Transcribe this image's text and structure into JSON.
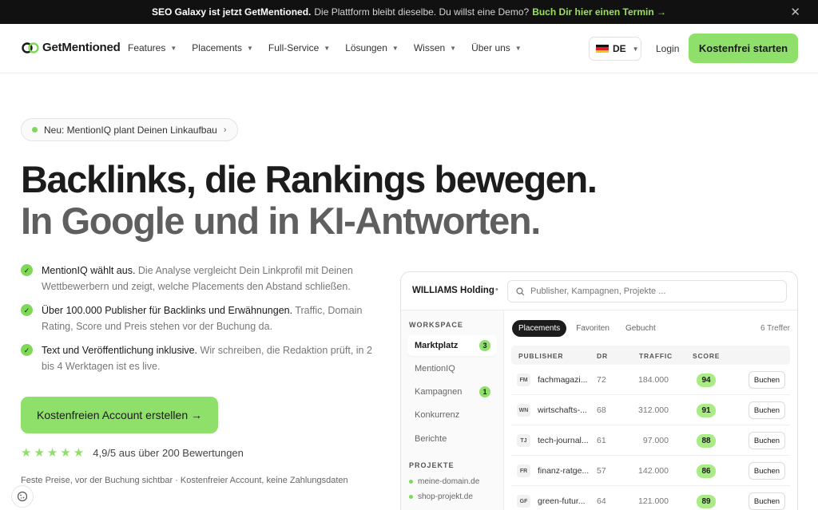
{
  "banner": {
    "bold": "SEO Galaxy ist jetzt GetMentioned.",
    "text": "Die Plattform bleibt dieselbe. Du willst eine Demo?",
    "link": "Buch Dir hier einen Termin →",
    "close": "✕"
  },
  "nav": {
    "brand": "GetMentioned",
    "menu": [
      {
        "label": "Features"
      },
      {
        "label": "Placements"
      },
      {
        "label": "Full-Service"
      },
      {
        "label": "Lösungen"
      },
      {
        "label": "Wissen"
      },
      {
        "label": "Über uns"
      }
    ],
    "language": "DE",
    "login": "Login",
    "cta": "Kostenfrei starten"
  },
  "hero": {
    "pill": "Neu: MentionIQ plant Deinen Linkaufbau",
    "headline_1": "Backlinks, die Rankings bewegen.",
    "headline_2": "In Google und in KI-Antworten.",
    "features": [
      {
        "strong": "MentionIQ wählt aus.",
        "text": "Die Analyse vergleicht Dein Linkprofil mit Deinen Wettbewerbern und zeigt, welche Placements den Abstand schließen."
      },
      {
        "strong": "Über 100.000 Publisher für Backlinks und Erwähnungen.",
        "text": "Traffic, Domain Rating, Score und Preis stehen vor der Buchung da."
      },
      {
        "strong": "Text und Veröffentlichung inklusive.",
        "text": "Wir schreiben, die Redaktion prüft, in 2 bis 4 Werktagen ist es live."
      }
    ],
    "cta": "Kostenfreien Account erstellen →",
    "stars": "★★★★★",
    "rating": "4,9/5 aus über 200 Bewertungen",
    "fineprint": "Feste Preise, vor der Buchung sichtbar · Kostenfreier Account, keine Zahlungsdaten"
  },
  "app": {
    "workspace_name": "WILLIAMS Holding",
    "separator": "•",
    "search_placeholder": "Publisher, Kampagnen, Projekte ...",
    "sidebar": {
      "workspace_heading": "WORKSPACE",
      "items": [
        {
          "label": "Marktplatz",
          "badge": "3"
        },
        {
          "label": "MentionIQ",
          "badge": ""
        },
        {
          "label": "Kampagnen",
          "badge": "1"
        },
        {
          "label": "Konkurrenz",
          "badge": ""
        },
        {
          "label": "Berichte",
          "badge": ""
        }
      ],
      "projects_heading": "PROJEKTE",
      "projects": [
        "meine-domain.de",
        "shop-projekt.de"
      ]
    },
    "tabs": [
      "Placements",
      "Favoriten",
      "Gebucht"
    ],
    "results": "6 Treffer",
    "columns": {
      "publisher": "PUBLISHER",
      "dr": "DR",
      "traffic": "TRAFFIC",
      "score": "SCORE"
    },
    "rows": [
      {
        "initials": "FM",
        "publisher": "fachmagazi...",
        "dr": "72",
        "traffic": "184.000",
        "score": "94",
        "action": "Buchen"
      },
      {
        "initials": "WN",
        "publisher": "wirtschafts-...",
        "dr": "68",
        "traffic": "312.000",
        "score": "91",
        "action": "Buchen"
      },
      {
        "initials": "TJ",
        "publisher": "tech-journal...",
        "dr": "61",
        "traffic": "97.000",
        "score": "88",
        "action": "Buchen"
      },
      {
        "initials": "FR",
        "publisher": "finanz-ratge...",
        "dr": "57",
        "traffic": "142.000",
        "score": "86",
        "action": "Buchen"
      },
      {
        "initials": "GF",
        "publisher": "green-futur...",
        "dr": "64",
        "traffic": "121.000",
        "score": "89",
        "action": "Buchen"
      }
    ]
  },
  "colors": {
    "accent": "#8fe06a",
    "banner_bg": "#111111",
    "banner_link": "#9be15d",
    "headline_dark": "#1c1c1c",
    "headline_gray": "#5f5f5f"
  }
}
